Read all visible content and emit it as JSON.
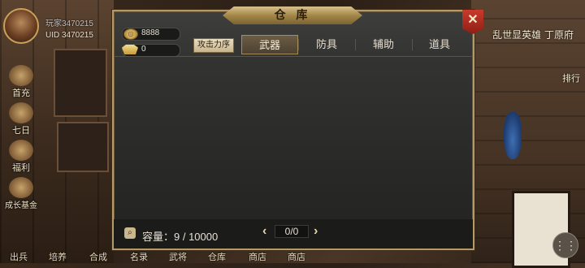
{
  "player": {
    "name": "玩家3470215",
    "uid": "UID 3470215"
  },
  "side_menu": [
    {
      "label": "首充"
    },
    {
      "label": "七日"
    },
    {
      "label": "福利"
    },
    {
      "label": "成长基金"
    }
  ],
  "bottom_bar": [
    {
      "label": "出兵"
    },
    {
      "label": "培养"
    },
    {
      "label": "合成"
    },
    {
      "label": "名录"
    },
    {
      "label": "武将"
    },
    {
      "label": "仓库"
    },
    {
      "label": "商店"
    },
    {
      "label": "商店"
    }
  ],
  "banner_right": "乱世显英雄 丁原府",
  "rank_tag": "排行",
  "panel": {
    "title": "仓 库",
    "close_icon": "crossed-swords-icon",
    "currency": [
      {
        "icon": "coin-icon",
        "value": "8888"
      },
      {
        "icon": "ingot-icon",
        "value": "0"
      }
    ],
    "sort_button": "攻击力序",
    "tabs": [
      {
        "label": "武器",
        "active": true
      },
      {
        "label": "防具",
        "active": false
      },
      {
        "label": "辅助",
        "active": false
      },
      {
        "label": "道具",
        "active": false
      }
    ],
    "capacity_label": "容量：",
    "capacity_value": "9 / 10000",
    "pager": {
      "prev": "‹",
      "value": "0/0",
      "next": "›"
    }
  },
  "colors": {
    "panel_border": "#b59a68",
    "title_plate": "#a48748",
    "close_red": "#c93a2b"
  }
}
